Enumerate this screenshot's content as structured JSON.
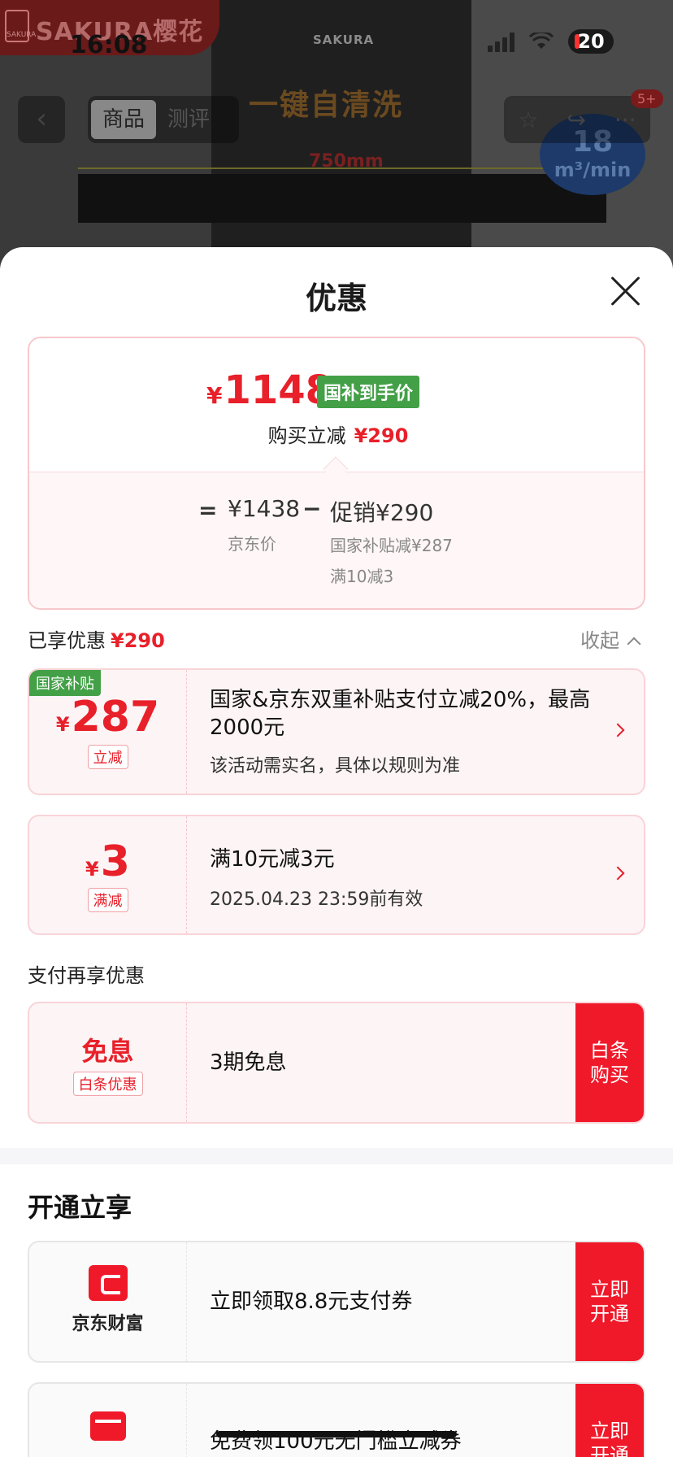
{
  "status_bar": {
    "time": "16:08",
    "battery": "20"
  },
  "background": {
    "brand_name": "SAKURA樱花",
    "brand_logo_text": "SAKURA",
    "promo_brand": "SAKURA",
    "promo_title": "一键自清洗",
    "promo_dimension": "750mm",
    "airflow_value": "18",
    "airflow_unit": "m³/min",
    "tabs": [
      "商品",
      "测评"
    ],
    "cart_badge": "5+"
  },
  "sheet": {
    "title": "优惠",
    "summary": {
      "currency": "¥",
      "final_price": "1148",
      "price_tag": "国补到手价",
      "reduce_label": "购买立减",
      "reduce_amount": "¥290",
      "equals": "=",
      "jd_price": "¥1438",
      "jd_price_label": "京东价",
      "minus": "−",
      "promo_amount": "促销¥290",
      "promo_detail_1": "国家补贴减¥287",
      "promo_detail_2": "满10减3"
    },
    "enjoyed_label": "已享优惠",
    "enjoyed_amount": "¥290",
    "collapse_label": "收起",
    "coupons": [
      {
        "tag": "国家补贴",
        "currency": "¥",
        "amount": "287",
        "type": "立减",
        "main": "国家&京东双重补贴支付立减20%，最高2000元",
        "sub": "该活动需实名，具体以规则为准"
      },
      {
        "currency": "¥",
        "amount": "3",
        "type": "满减",
        "main": "满10元减3元",
        "sub": "2025.04.23 23:59前有效"
      }
    ],
    "pay_section_label": "支付再享优惠",
    "pay_offer": {
      "title": "免息",
      "type": "白条优惠",
      "main": "3期免息",
      "button_line1": "白条",
      "button_line2": "购买"
    },
    "open_section_title": "开通立享",
    "open_offers": [
      {
        "name": "京东财富",
        "icon": "jd-wealth-icon",
        "main": "立即领取8.8元支付券",
        "button_line1": "立即",
        "button_line2": "开通"
      },
      {
        "icon": "bank-card-icon",
        "main": "免费领100元无门槛立减券",
        "button_line1": "立即",
        "button_line2": "开通"
      }
    ]
  },
  "colors": {
    "accent": "#e8202a",
    "guobu_green": "#43a047",
    "button_red": "#f0192a"
  }
}
